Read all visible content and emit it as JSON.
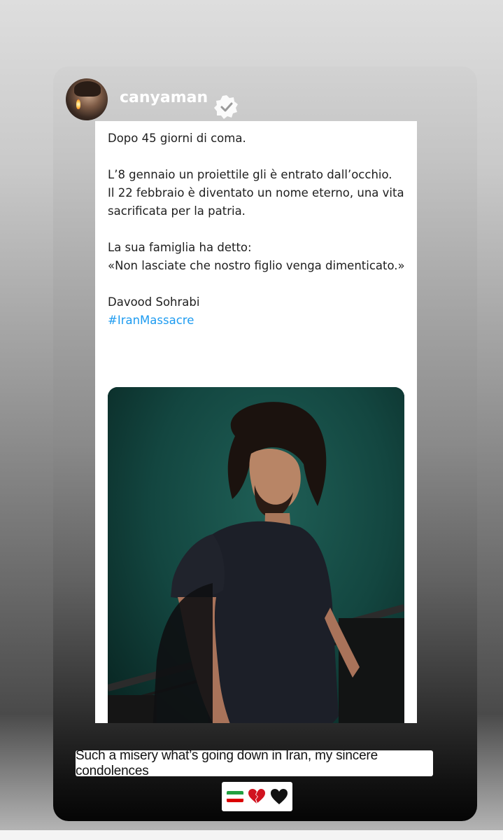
{
  "story": {
    "username": "canyaman",
    "verified": true
  },
  "tweet": {
    "lines": {
      "p1": "Dopo 45 giorni di coma.",
      "p2a": "L’8 gennaio un proiettile gli è entrato dall’occhio.",
      "p2b": "Il 22 febbraio è diventato un nome eterno, una vita sacrificata per la patria.",
      "p3a": "La sua famiglia ha detto:",
      "p3b": "«Non lasciate che nostro figlio venga dimenticato.»",
      "p4": "Davood Sohrabi",
      "hashtag": "#IranMassacre"
    }
  },
  "caption": {
    "text": "Such a misery what’s going down in Iran, my sincere condolences",
    "emojis": [
      "iran-flag-icon",
      "broken-heart-icon",
      "black-heart-icon"
    ]
  },
  "colors": {
    "hashtag": "#1d9bf0",
    "verified_badge": "#ffffff",
    "flag_green": "#239f40",
    "flag_white": "#ffffff",
    "flag_red": "#da0000",
    "broken_heart": "#d1131f",
    "black_heart": "#111111"
  }
}
